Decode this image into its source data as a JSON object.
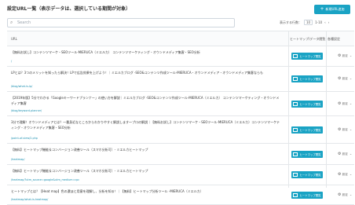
{
  "header": {
    "title": "設定URL一覧（表示データは、選択している期間が対象）",
    "add_button_label": "新規URL追加",
    "plus_icon": "plus-icon"
  },
  "search": {
    "placeholder": "Search"
  },
  "pagination": {
    "per_page_label": "表示する行数：",
    "per_page_value": "10",
    "range": "1-10"
  },
  "table": {
    "headers": {
      "url": "URL",
      "heatmap": "ヒートマップ/データ閲覧",
      "settings": "各種設定"
    },
    "rows": [
      {
        "title": "【無料お試し】コンテンツマーケ・SEOツール-MIERUCA（ミエルカ） コンテンツマーケティング・オウンドメディア集客・SEO分析",
        "url": "/",
        "button": "ヒートマップ閲覧",
        "settings": "設定"
      },
      {
        "title": "LPとは？3つのメリットを知ったら解決！LPで広告効果を上げよう！｜ミエルカブログ -SEO&コンテンツ作成ツール-MIERUCA・オウンドメディア・オウンドメディア集客ならも",
        "url": "/blog/what-is-lp/",
        "button": "ヒートマップ閲覧",
        "settings": "設定"
      },
      {
        "title": "【2019年版】5分でわかる「Googleキーワードプランナー」の使い方を解説｜ミエルカブログ -SEO&コンテンツ作成ツール-MIERUCA（ミエルカ） コンテンツマーケティング・オウンドメディア集客",
        "url": "/blog/keyword-planner/",
        "button": "ヒートマップ閲覧",
        "settings": "設定"
      },
      {
        "title": "3分で理解！オウンドメディアとは？一番身近なところからわかりやすく解説します～プロの解説｜【無料お試し】コンテンツマーケ・SEOツール-MIERUCA（ミエルカ）コンテンツマーケティング・オウンドメディア集客・SEO分析",
        "url": "/point-of-view/2.php",
        "button": "ヒートマップ閲覧",
        "settings": "設定"
      },
      {
        "title": "【無料】ヒートマップ機能＆コンバージョン改善ツール（スマホ分析可）- ミエルカヒートマップ",
        "url": "/heatmap/",
        "button": "ヒートマップ閲覧",
        "settings": "設定"
      },
      {
        "title": "【無料】ヒートマップ機能＆コンバージョン改善ツール（スマホ分析可）- ミエルカヒートマップ",
        "url": "/heatmap/?utm_source=google&utm_medium=cpc",
        "button": "ヒートマップ閲覧",
        "settings": "設定"
      },
      {
        "title": "ヒートマップとは？【Heat map】色の濃淡と用意を理解し、分析を知る！｜【無料】ヒートマップ分析ツール -MIERUCA（ミエルカ）",
        "url": "/heatmap/what-is-heatmap/",
        "button": "ヒートマップ閲覧",
        "settings": "設定"
      }
    ]
  }
}
